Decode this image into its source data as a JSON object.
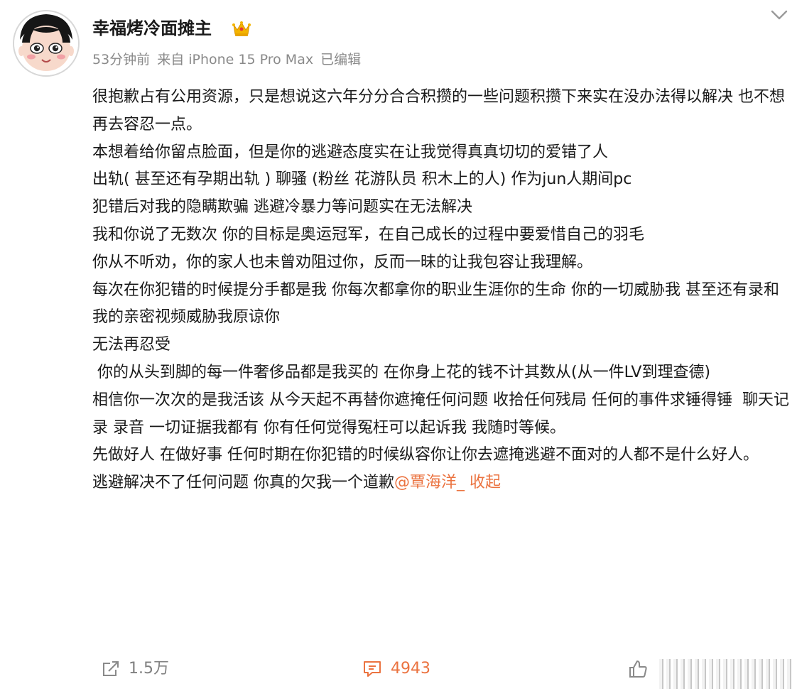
{
  "author": {
    "name": "幸福烤冷面摊主",
    "badge_icon": "crown-icon"
  },
  "meta": {
    "time": "53分钟前",
    "source": "来自 iPhone 15 Pro Max",
    "edited": "已编辑"
  },
  "post": {
    "paragraphs": [
      "很抱歉占有公用资源，只是想说这六年分分合合积攒的一些问题积攒下来实在没办法得以解决 也不想再去容忍一点。",
      "本想着给你留点脸面，但是你的逃避态度实在让我觉得真真切切的爱错了人",
      "出轨( 甚至还有孕期出轨 ) 聊骚 (粉丝 花游队员 积木上的人) 作为jun人期间pc",
      "犯错后对我的隐瞒欺骗 逃避冷暴力等问题实在无法解决",
      "我和你说了无数次 你的目标是奥运冠军，在自己成长的过程中要爱惜自己的羽毛",
      "你从不听劝，你的家人也未曾劝阻过你，反而一昧的让我包容让我理解。",
      "每次在你犯错的时候提分手都是我 你每次都拿你的职业生涯你的生命 你的一切威胁我 甚至还有录和我的亲密视频威胁我原谅你",
      "无法再忍受",
      " 你的从头到脚的每一件奢侈品都是我买的 在你身上花的钱不计其数从(从一件LV到理查德)",
      "相信你一次次的是我活该 从今天起不再替你遮掩任何问题 收拾任何残局 任何的事件求锤得锤  聊天记录 录音 一切证据我都有 你有任何觉得冤枉可以起诉我 我随时等候。",
      "先做好人 在做好事 任何时期在你犯错的时候纵容你让你去遮掩逃避不面对的人都不是什么好人。"
    ],
    "last_line_text": "逃避解决不了任何问题 你真的欠我一个道歉",
    "mention": "@覃海洋_",
    "collapse_label": "收起"
  },
  "actions": {
    "repost_icon": "share-icon",
    "repost_count": "1.5万",
    "comment_icon": "comment-icon",
    "comment_count": "4943",
    "like_icon": "thumbs-up-icon"
  },
  "colors": {
    "accent": "#eb7340",
    "text": "#1a1a1a",
    "meta": "#8a8a8a"
  }
}
